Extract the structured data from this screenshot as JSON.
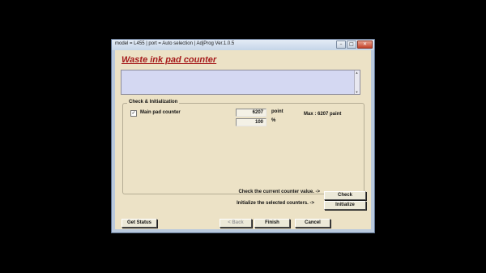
{
  "window": {
    "title": "model = L455 | port = Auto selection | AdjProg Ver.1.0.5",
    "controls": {
      "minimize": "–",
      "maximize": "□",
      "close": "✕"
    }
  },
  "heading": "Waste ink pad counter",
  "check_group": {
    "label": "Check & Initialization",
    "main_pad": {
      "checked": true,
      "check_glyph": "✓",
      "label": "Main pad counter",
      "value": "6207",
      "unit": "point",
      "percent_value": "100",
      "percent_unit": "%",
      "max_text": "Max : 6207 paint"
    },
    "check_hint": "Check the current counter value. ->",
    "check_button": "Check",
    "init_hint": "Initialize the selected counters. ->",
    "init_button": "Initialize"
  },
  "footer": {
    "get_status": "Get Status",
    "back": "< Back",
    "finish": "Finish",
    "cancel": "Cancel"
  }
}
